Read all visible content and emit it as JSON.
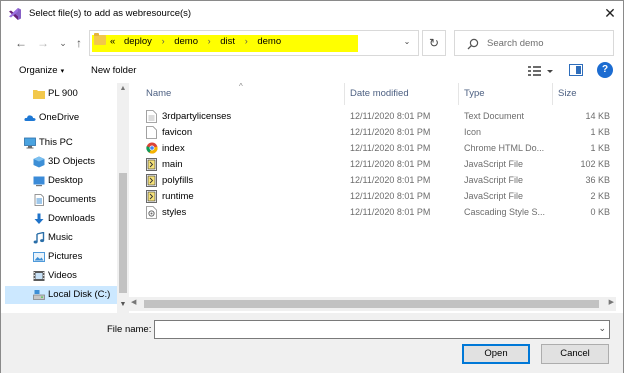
{
  "window": {
    "title": "Select file(s) to add as webresource(s)",
    "close_glyph": "✕"
  },
  "nav": {
    "back_glyph": "←",
    "forward_glyph": "→",
    "recent_glyph": "⌄",
    "up_glyph": "↑",
    "breadcrumb_prefix": "«",
    "breadcrumbs": [
      "deploy",
      "demo",
      "dist",
      "demo"
    ],
    "crumb_separator": "›",
    "dropdown_glyph": "⌄",
    "refresh_glyph": "↻",
    "search_placeholder": "Search demo"
  },
  "toolbar": {
    "organize_label": "Organize",
    "organize_caret": "▾",
    "new_folder_label": "New folder",
    "help_glyph": "?"
  },
  "sidebar": {
    "items": [
      {
        "label": "PL 900",
        "icon": "folder-icon"
      },
      {
        "label": "OneDrive",
        "icon": "cloud-icon"
      },
      {
        "label": "This PC",
        "icon": "computer-icon"
      },
      {
        "label": "3D Objects",
        "icon": "cube-icon"
      },
      {
        "label": "Desktop",
        "icon": "desktop-icon"
      },
      {
        "label": "Documents",
        "icon": "documents-icon"
      },
      {
        "label": "Downloads",
        "icon": "download-icon"
      },
      {
        "label": "Music",
        "icon": "music-icon"
      },
      {
        "label": "Pictures",
        "icon": "pictures-icon"
      },
      {
        "label": "Videos",
        "icon": "videos-icon"
      },
      {
        "label": "Local Disk (C:)",
        "icon": "drive-icon",
        "selected": true
      }
    ]
  },
  "columns": {
    "name": "Name",
    "date_modified": "Date modified",
    "type": "Type",
    "size": "Size",
    "sort_glyph": "^"
  },
  "files": [
    {
      "name": "3rdpartylicenses",
      "date": "12/11/2020 8:01 PM",
      "type": "Text Document",
      "size": "14 KB",
      "icon": "text-file-icon"
    },
    {
      "name": "favicon",
      "date": "12/11/2020 8:01 PM",
      "type": "Icon",
      "size": "1 KB",
      "icon": "icon-file-icon"
    },
    {
      "name": "index",
      "date": "12/11/2020 8:01 PM",
      "type": "Chrome HTML Do...",
      "size": "1 KB",
      "icon": "chrome-icon"
    },
    {
      "name": "main",
      "date": "12/11/2020 8:01 PM",
      "type": "JavaScript File",
      "size": "102 KB",
      "icon": "js-file-icon"
    },
    {
      "name": "polyfills",
      "date": "12/11/2020 8:01 PM",
      "type": "JavaScript File",
      "size": "36 KB",
      "icon": "js-file-icon"
    },
    {
      "name": "runtime",
      "date": "12/11/2020 8:01 PM",
      "type": "JavaScript File",
      "size": "2 KB",
      "icon": "js-file-icon"
    },
    {
      "name": "styles",
      "date": "12/11/2020 8:01 PM",
      "type": "Cascading Style S...",
      "size": "0 KB",
      "icon": "css-file-icon"
    }
  ],
  "bottom": {
    "file_name_label": "File name:",
    "file_name_value": "",
    "open_label": "Open",
    "cancel_label": "Cancel"
  },
  "colors": {
    "highlight": "#ffff00",
    "selection": "#cce8ff",
    "accent": "#0078d7"
  }
}
